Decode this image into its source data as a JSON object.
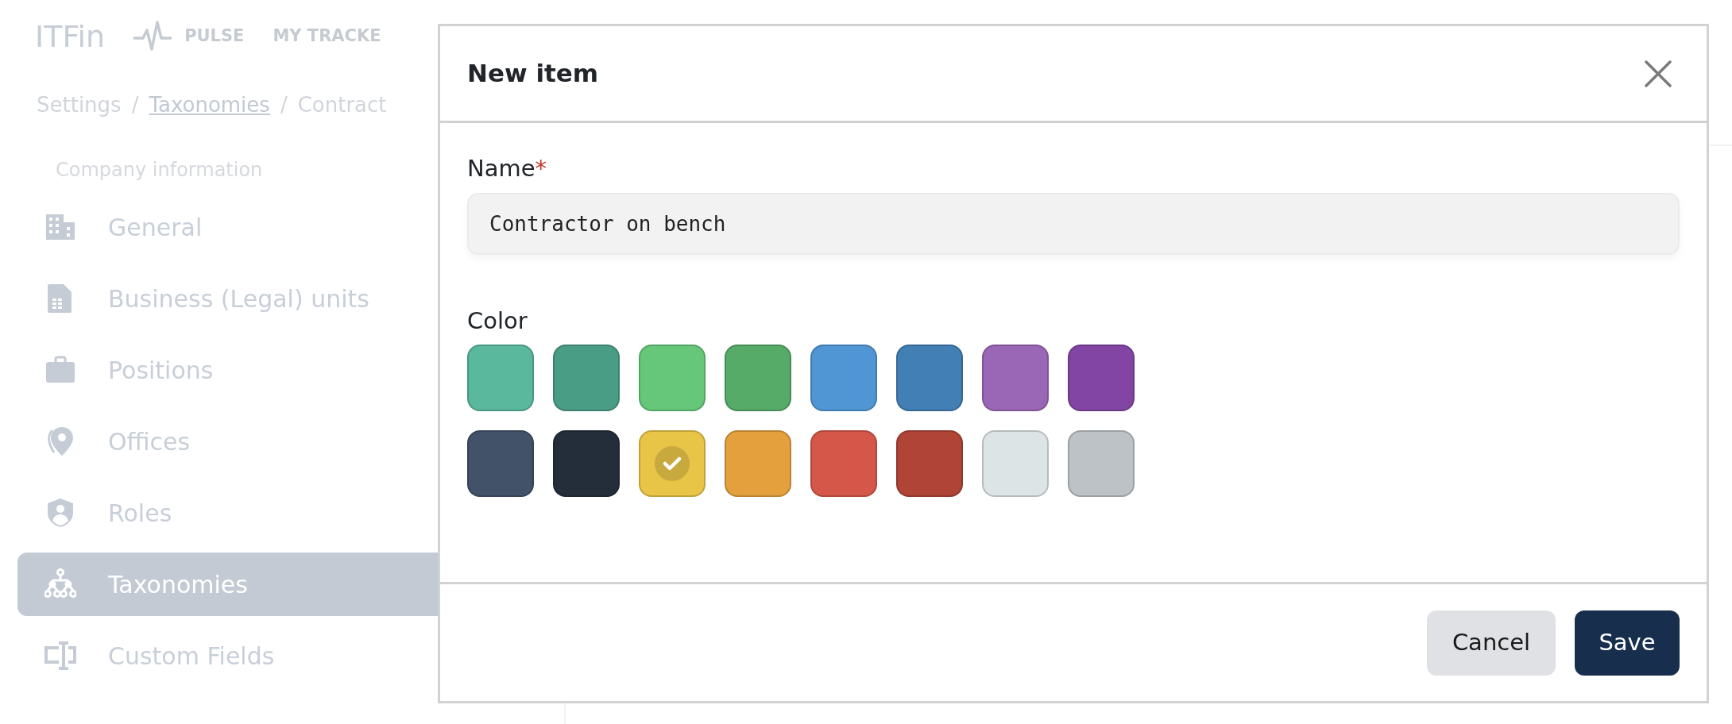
{
  "header": {
    "logo": "ITFin",
    "nav": [
      {
        "label": "PULSE"
      },
      {
        "label": "MY TRACKE"
      }
    ]
  },
  "breadcrumb": [
    {
      "kind": "crumb",
      "text": "Settings"
    },
    {
      "kind": "separator",
      "text": "/"
    },
    {
      "kind": "link",
      "text": "Taxonomies"
    },
    {
      "kind": "separator",
      "text": "/"
    },
    {
      "kind": "crumb",
      "text": "Contract"
    }
  ],
  "sidebar": {
    "section": "Company information",
    "items": [
      {
        "label": "General",
        "selected": false
      },
      {
        "label": "Business (Legal) units",
        "selected": false
      },
      {
        "label": "Positions",
        "selected": false
      },
      {
        "label": "Offices",
        "selected": false
      },
      {
        "label": "Roles",
        "selected": false
      },
      {
        "label": "Taxonomies",
        "selected": true
      },
      {
        "label": "Custom Fields",
        "selected": false
      }
    ]
  },
  "modal": {
    "title": "New item",
    "name_field": {
      "label": "Name",
      "required_mark": "*",
      "value": "Contractor on bench"
    },
    "color_label": "Color",
    "swatches": [
      {
        "color": "#5ab89d",
        "selected": false
      },
      {
        "color": "#4a9d85",
        "selected": false
      },
      {
        "color": "#66c77a",
        "selected": false
      },
      {
        "color": "#56ab69",
        "selected": false
      },
      {
        "color": "#5096d4",
        "selected": false
      },
      {
        "color": "#427fb4",
        "selected": false
      },
      {
        "color": "#9a66b6",
        "selected": false
      },
      {
        "color": "#8345a4",
        "selected": false
      },
      {
        "color": "#415269",
        "selected": false
      },
      {
        "color": "#242e3b",
        "selected": false
      },
      {
        "color": "#e8c547",
        "selected": true
      },
      {
        "color": "#e3a03d",
        "selected": false
      },
      {
        "color": "#d5574a",
        "selected": false
      },
      {
        "color": "#b04436",
        "selected": false
      },
      {
        "color": "#dde4e6",
        "selected": false
      },
      {
        "color": "#bdc2c6",
        "selected": false
      }
    ],
    "buttons": [
      {
        "label": "Cancel",
        "kind": "secondary"
      },
      {
        "label": "Save",
        "kind": "primary"
      }
    ]
  }
}
